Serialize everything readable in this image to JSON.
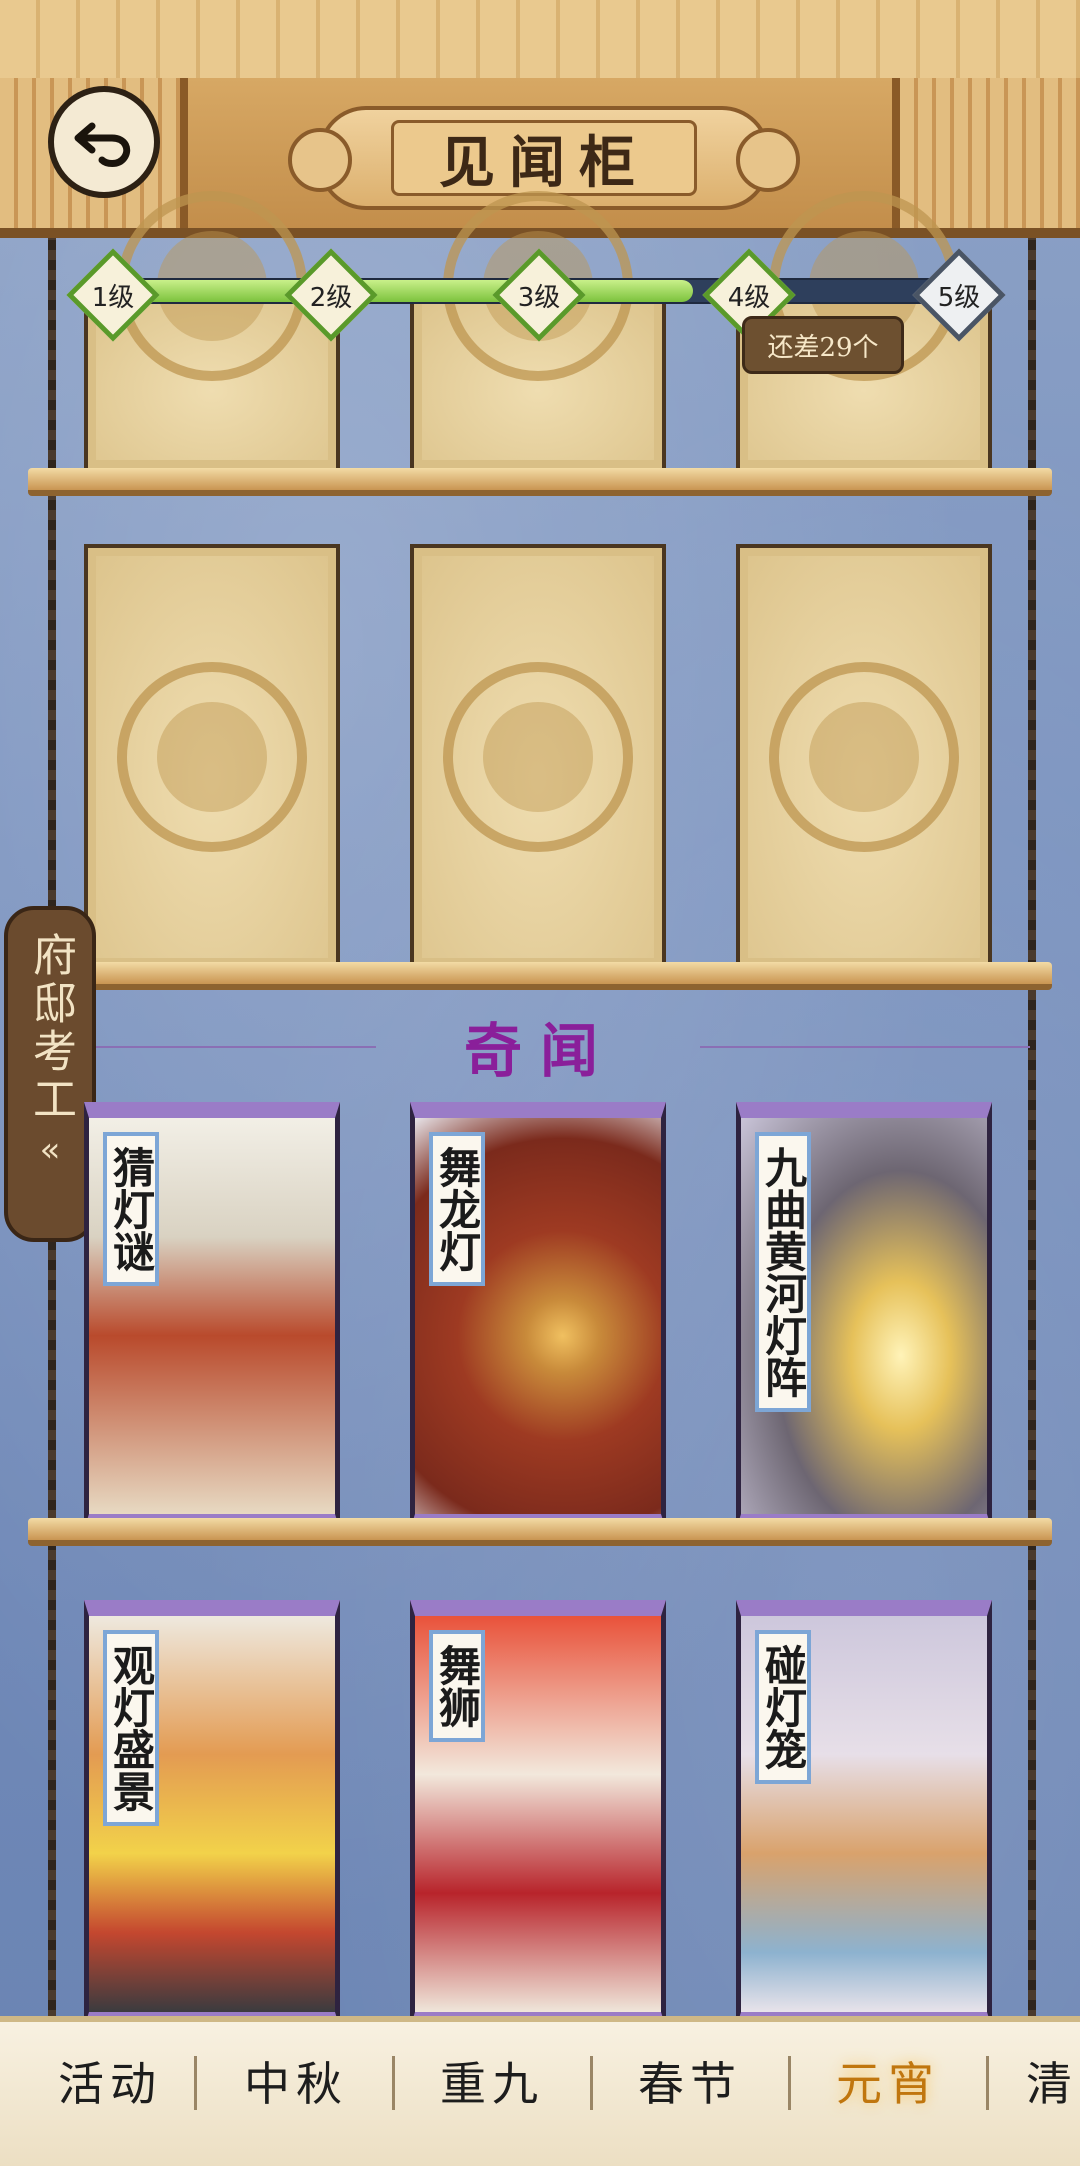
{
  "header": {
    "title": "见闻柜",
    "back_icon": "back-arrow-icon"
  },
  "progress": {
    "levels": [
      "1级",
      "2级",
      "3级",
      "4级",
      "5级"
    ],
    "fraction_filled": 0.68,
    "remaining_text": "还差29个"
  },
  "section": {
    "title": "奇闻"
  },
  "side_tab": {
    "label": "府邸考工",
    "chevron": "«"
  },
  "cards": [
    {
      "title": "猜灯谜"
    },
    {
      "title": "舞龙灯"
    },
    {
      "title": "九曲黄河灯阵"
    },
    {
      "title": "观灯盛景"
    },
    {
      "title": "舞狮"
    },
    {
      "title": "碰灯笼"
    }
  ],
  "tabs": [
    "活动",
    "中秋",
    "重九",
    "春节",
    "元宵",
    "清"
  ],
  "active_tab": "元宵",
  "colors": {
    "accent": "#c0760e",
    "section_title": "#8a1f9a",
    "progress_fill": "#7cc23d"
  }
}
